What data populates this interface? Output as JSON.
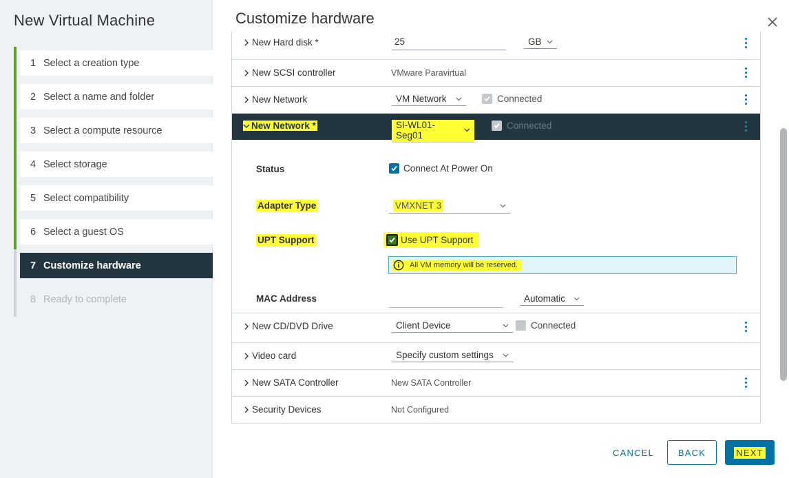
{
  "sidebar": {
    "title": "New Virtual Machine",
    "steps": [
      {
        "num": "1",
        "label": "Select a creation type"
      },
      {
        "num": "2",
        "label": "Select a name and folder"
      },
      {
        "num": "3",
        "label": "Select a compute resource"
      },
      {
        "num": "4",
        "label": "Select storage"
      },
      {
        "num": "5",
        "label": "Select compatibility"
      },
      {
        "num": "6",
        "label": "Select a guest OS"
      },
      {
        "num": "7",
        "label": "Customize hardware"
      },
      {
        "num": "8",
        "label": "Ready to complete"
      }
    ]
  },
  "main": {
    "title": "Customize hardware",
    "hard_disk": {
      "label": "New Hard disk *",
      "size": "25",
      "unit": "GB"
    },
    "scsi": {
      "label": "New SCSI controller",
      "value": "VMware Paravirtual"
    },
    "network1": {
      "label": "New Network",
      "value": "VM Network",
      "connected": "Connected"
    },
    "network2": {
      "label": "New Network *",
      "value": "SI-WL01-Seg01",
      "connected": "Connected",
      "status_label": "Status",
      "status_value": "Connect At Power On",
      "adapter_label": "Adapter Type",
      "adapter_value": "VMXNET 3",
      "upt_label": "UPT Support",
      "upt_value": "Use UPT Support",
      "upt_info": "All VM memory will be reserved.",
      "mac_label": "MAC Address",
      "mac_value": "",
      "mac_mode": "Automatic"
    },
    "cddvd": {
      "label": "New CD/DVD Drive",
      "value": "Client Device",
      "connected": "Connected"
    },
    "video": {
      "label": "Video card",
      "value": "Specify custom settings"
    },
    "sata": {
      "label": "New SATA Controller",
      "value": "New SATA Controller"
    },
    "security": {
      "label": "Security Devices",
      "value": "Not Configured"
    }
  },
  "footer": {
    "cancel": "CANCEL",
    "back": "BACK",
    "next": "NEXT"
  },
  "colors": {
    "accent": "#0072a3",
    "nav_active": "#23353f",
    "rail": "#5aa220",
    "highlight": "#ffff33"
  }
}
